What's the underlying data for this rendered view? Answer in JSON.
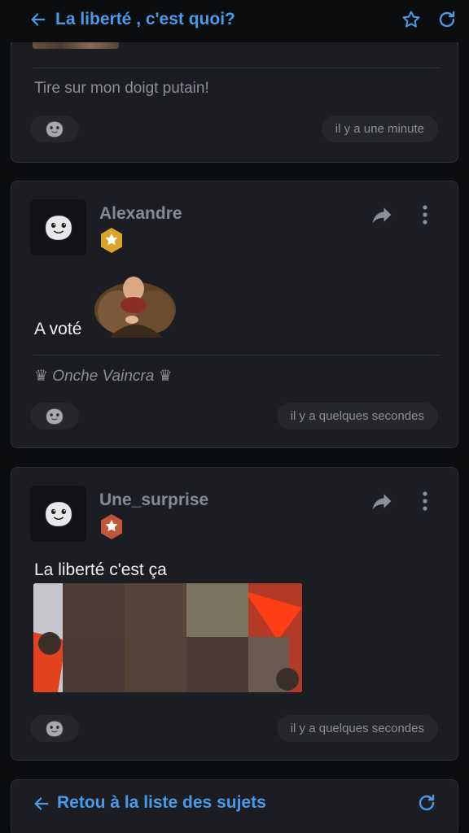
{
  "header": {
    "title": "La liberté , c'est quoi?",
    "icons": [
      "arrow-left-icon",
      "star-icon",
      "refresh-icon"
    ]
  },
  "posts": [
    {
      "message": "Tire sur mon doigt putain!",
      "time": "il y a une minute"
    },
    {
      "username": "Alexandre",
      "badge": "gold-star-badge",
      "message": "A voté",
      "signature": "♛ Onche Vaincra ♛",
      "time": "il y a quelques secondes"
    },
    {
      "username": "Une_surprise",
      "badge": "copper-star-badge",
      "message": "La liberté c'est ça",
      "time": "il y a quelques secondes"
    }
  ],
  "footer": {
    "back_label": "Retou à la liste des sujets"
  },
  "colors": {
    "accent": "#4a9ae8",
    "background": "#0c0d0f",
    "card": "#1c1d22",
    "muted_text": "#8c8e95"
  }
}
